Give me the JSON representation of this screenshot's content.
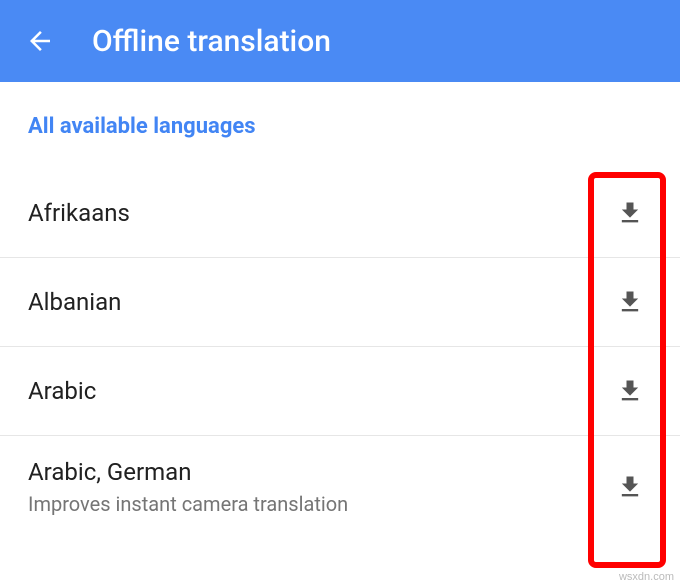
{
  "header": {
    "title": "Offline translation"
  },
  "section": {
    "title": "All available languages"
  },
  "languages": [
    {
      "name": "Afrikaans",
      "sub": ""
    },
    {
      "name": "Albanian",
      "sub": ""
    },
    {
      "name": "Arabic",
      "sub": ""
    },
    {
      "name": "Arabic, German",
      "sub": "Improves instant camera translation"
    }
  ],
  "watermark": "wsxdn.com"
}
